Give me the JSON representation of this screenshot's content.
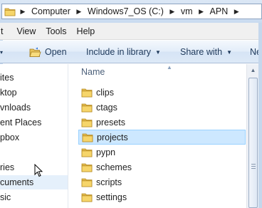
{
  "address_bar": {
    "crumbs": [
      "Computer",
      "Windows7_OS (C:)",
      "vm",
      "APN"
    ]
  },
  "menu": {
    "items": [
      "t",
      "View",
      "Tools",
      "Help"
    ]
  },
  "commands": {
    "open": "Open",
    "include": "Include in library",
    "share": "Share with",
    "next": "Ne"
  },
  "nav": {
    "items": [
      "ites",
      "ktop",
      "vnloads",
      "ent Places",
      "pbox",
      "ries",
      "cuments",
      "sic"
    ],
    "selected_index": 6
  },
  "files": {
    "column_name": "Name",
    "items": [
      "clips",
      "ctags",
      "presets",
      "projects",
      "pypn",
      "schemes",
      "scripts",
      "settings"
    ],
    "selected": "projects"
  },
  "icons": {
    "folder": "folder-icon",
    "open": "open-folder-icon",
    "cursor": "mouse-cursor-icon"
  },
  "colors": {
    "selection_fill": "#cde8ff",
    "selection_border": "#99d1ff",
    "folder_yellow": "#f6d56a"
  }
}
